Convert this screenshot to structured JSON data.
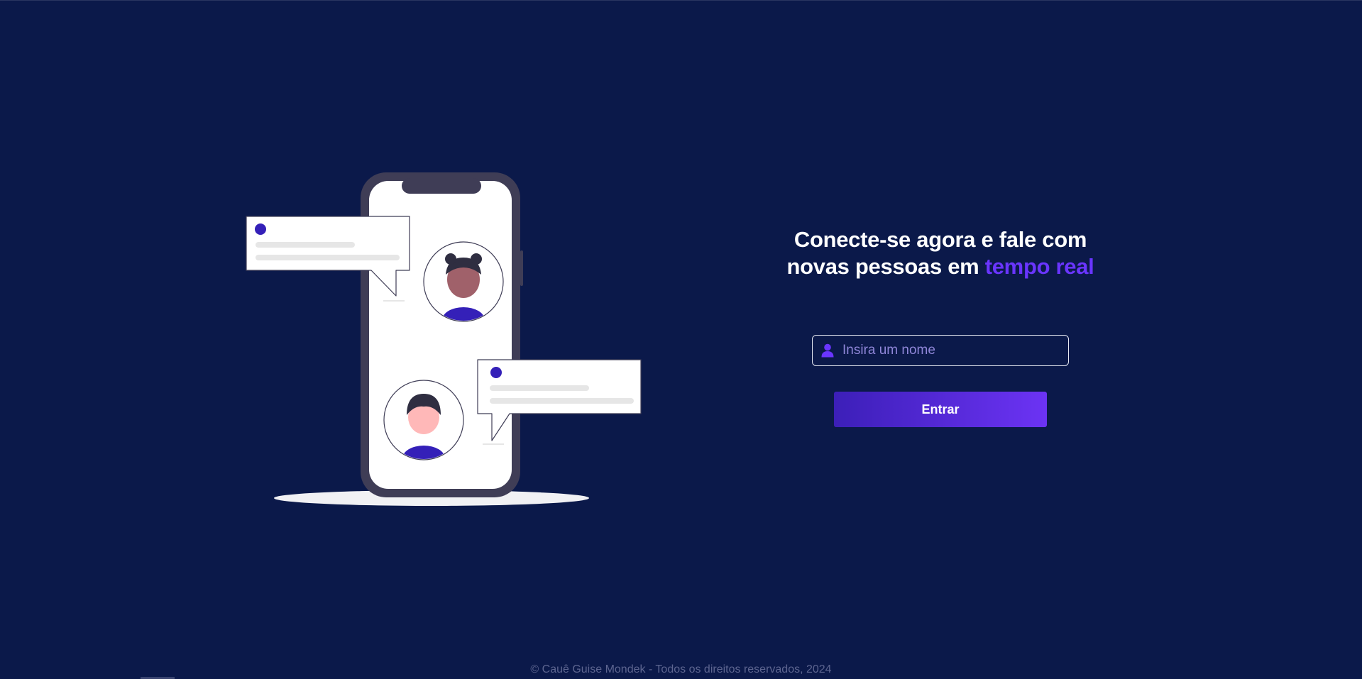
{
  "hero": {
    "headline_line1": "Conecte-se agora e fale com",
    "headline_line2_plain": "novas pessoas em ",
    "headline_line2_accent": "tempo real",
    "accent_color": "#6a35ff"
  },
  "login": {
    "name_placeholder": "Insira um nome",
    "name_value": "",
    "field_icon": "user-icon",
    "submit_label": "Entrar"
  },
  "illustration": {
    "subject": "chat-phone-illustration",
    "icons": [
      "phone-icon",
      "chat-bubble-icon",
      "avatar-icon"
    ]
  },
  "footer": {
    "text": "© Cauê Guise Mondek - Todos os direitos reservados, 2024"
  },
  "colors": {
    "background": "#0b194a",
    "button_gradient_start": "#3c1fb8",
    "button_gradient_end": "#6c33f4",
    "avatar_shirt": "#3420b8"
  }
}
